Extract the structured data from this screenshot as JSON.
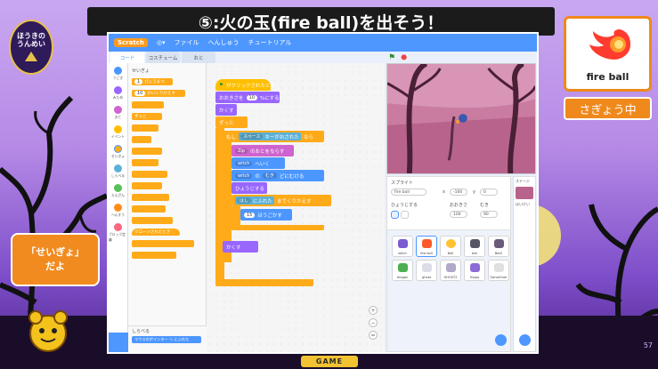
{
  "slide": {
    "title": "⑤:火の玉(fire ball)を出そう！",
    "logo_lines": [
      "ほうきの",
      "うんめい"
    ],
    "card_label": "fire ball",
    "status": "さぎょう中",
    "speech_line1": "「せいぎょ」",
    "speech_line2": "だよ",
    "page_number": "57",
    "footer": "GAME"
  },
  "editor": {
    "menu": {
      "brand": "Scratch",
      "file": "ファイル",
      "edit": "へんしゅう",
      "tutorial": "チュートリアル"
    },
    "tabs": [
      "コード",
      "コスチューム",
      "おと"
    ],
    "categories": [
      {
        "label": "うごき",
        "color": "#4c97ff"
      },
      {
        "label": "みため",
        "color": "#9966ff"
      },
      {
        "label": "おと",
        "color": "#cf63cf"
      },
      {
        "label": "イベント",
        "color": "#ffbf00"
      },
      {
        "label": "せいぎょ",
        "color": "#ffab19"
      },
      {
        "label": "しらべる",
        "color": "#5cb1d6"
      },
      {
        "label": "えんざん",
        "color": "#59c059"
      },
      {
        "label": "へんすう",
        "color": "#ff8c1a"
      },
      {
        "label": "ブロック定義",
        "color": "#ff6680"
      }
    ],
    "palette": {
      "section": "せいぎょ",
      "wait_label": "1",
      "wait_unit": "びょうまつ",
      "repeat_label": "10",
      "repeat_unit": "かいくりかえす",
      "forever_label": "ずっと",
      "clone_label": "クローンされたとき",
      "bottom_section": "しらべる",
      "bottom_block": "マウスのポインター へ にふれた"
    },
    "script": {
      "when_flag": "がクリックされたとき",
      "go_front": "おおきさを",
      "size_value": "10",
      "size_unit": "%にする",
      "hide": "かくす",
      "forever": "ずっと",
      "if_label": "もし",
      "key": "スペース",
      "key_pressed": "キーがおされた",
      "then": "なら",
      "goto_sprite": "Zip",
      "goto_suffix": "のおとをならす",
      "goto_target": "witch",
      "goto_label": "へいく",
      "dir_target": "witch",
      "dir_key": "の",
      "dir_prop": "むき",
      "dir_suffix": "どにむける",
      "show": "ひょうじする",
      "until_edge": "はし",
      "until_label": "にふれた",
      "until_suffix": "までくりかえす",
      "move_steps": "15",
      "move_label": "ほうごかす",
      "hide2": "かくす"
    },
    "sprite_info": {
      "header": "スプライト",
      "name": "fire ball",
      "x": "x",
      "y": "y",
      "x_val": "-100",
      "y_val": "0",
      "show_label": "ひょうじする",
      "size_label": "おおきさ",
      "direction_label": "むき",
      "size_val": "100",
      "direction_val": "90"
    },
    "sprites": [
      {
        "name": "witch",
        "color": "#7a5bd1"
      },
      {
        "name": "fire ball",
        "color": "#ff5a2b"
      },
      {
        "name": "Ball",
        "color": "#ffc233"
      },
      {
        "name": "bat",
        "color": "#555566"
      },
      {
        "name": "Bat2",
        "color": "#6a5a7a"
      },
      {
        "name": "dragon",
        "color": "#4caf50"
      },
      {
        "name": "ghost",
        "color": "#dcdce8"
      },
      {
        "name": "GHOST2",
        "color": "#b0a9c7"
      },
      {
        "name": "Hippo",
        "color": "#8c6bd6"
      },
      {
        "name": "GameOver",
        "color": "#e0e0e0"
      }
    ],
    "stage_pane": {
      "title": "ステージ",
      "backdrop": "はいけい"
    }
  }
}
